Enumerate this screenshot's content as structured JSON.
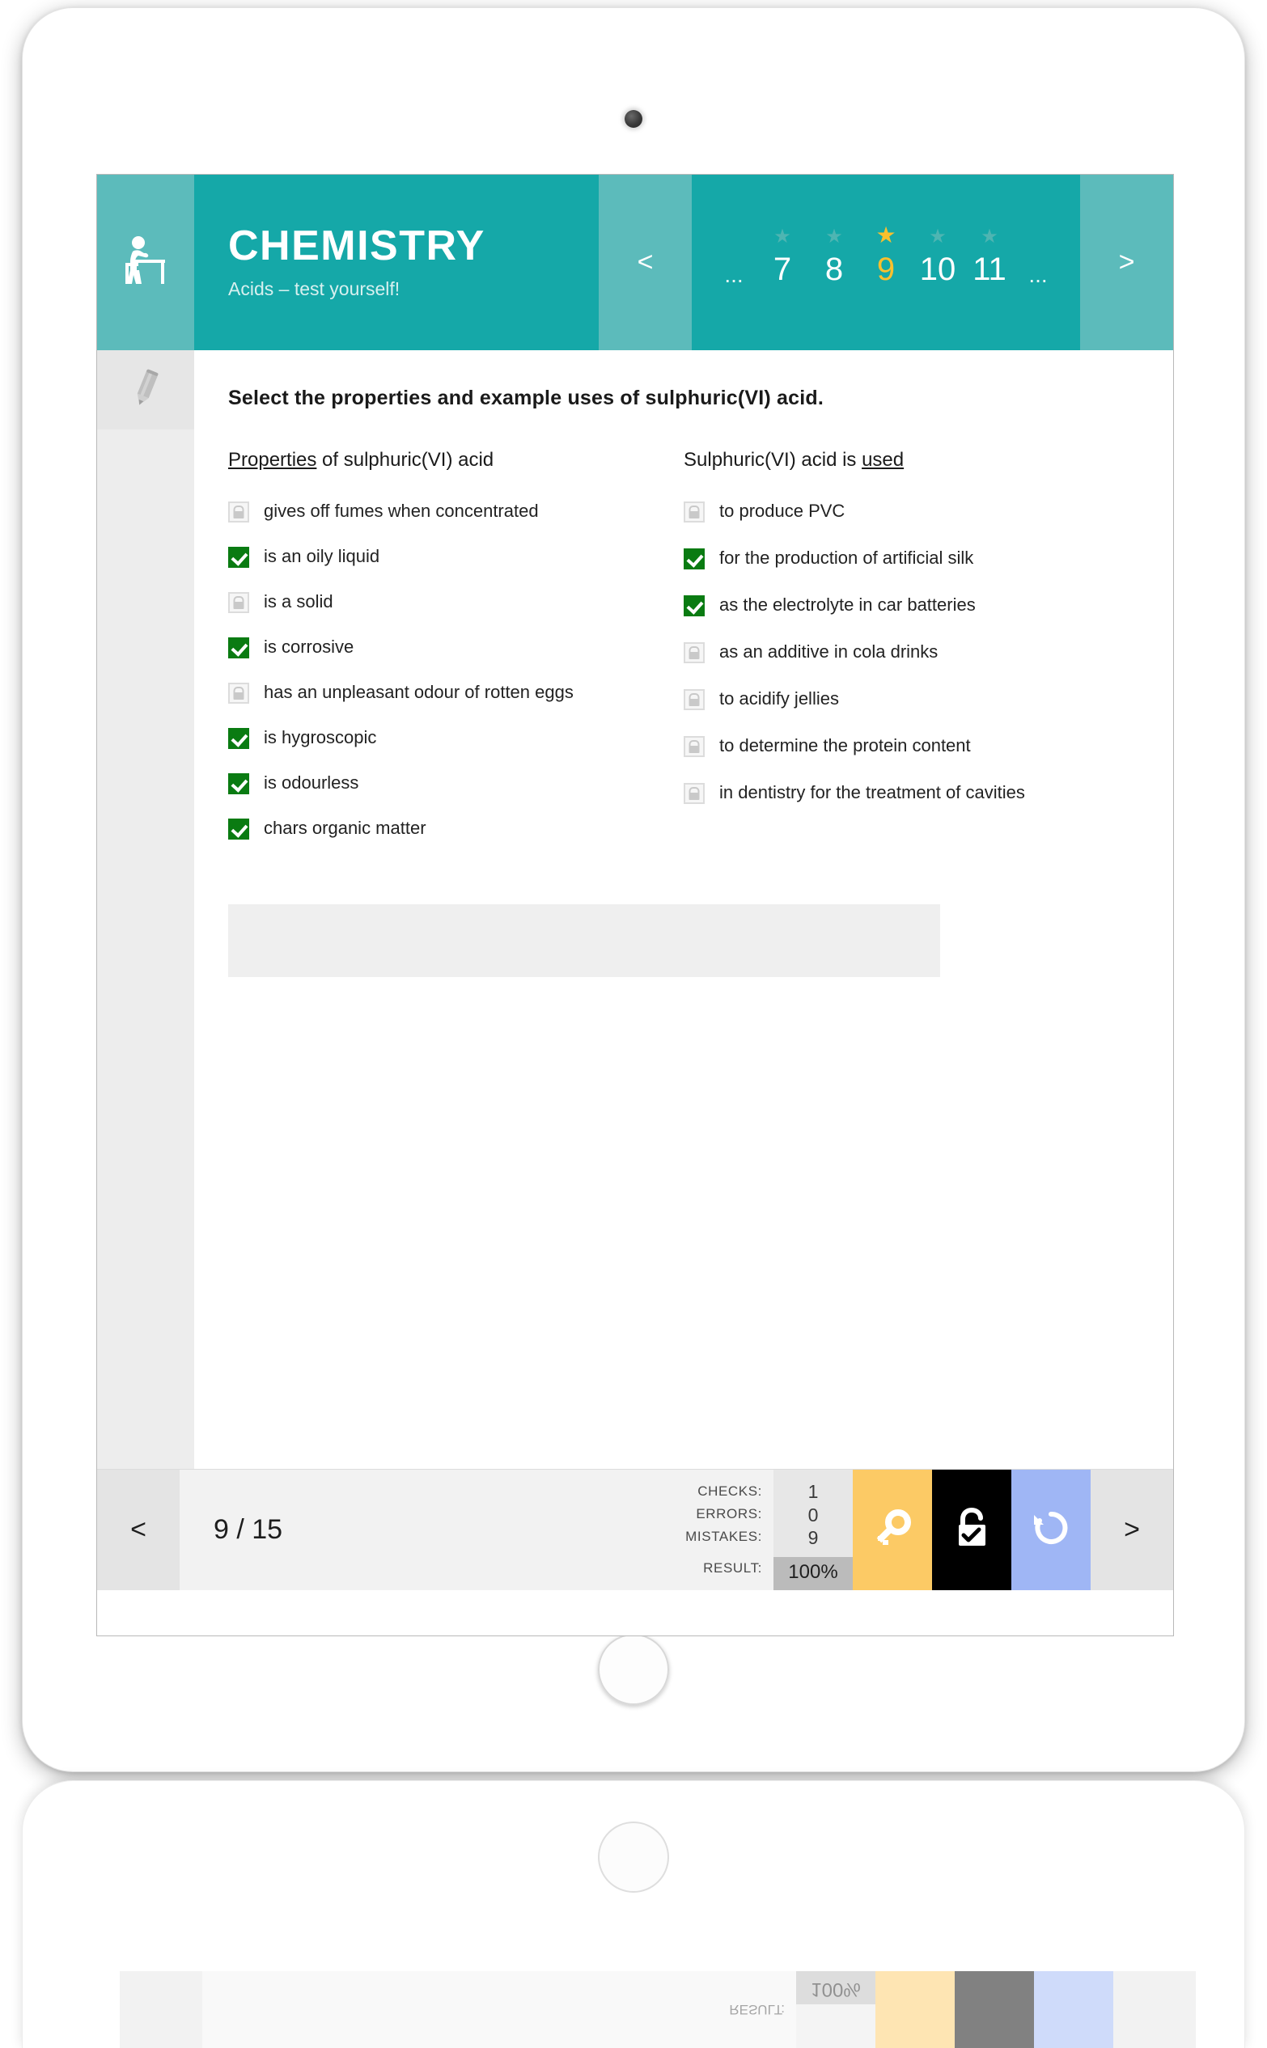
{
  "app": {
    "header": {
      "title": "CHEMISTRY",
      "subtitle": "Acids – test yourself!",
      "student_icon": "student-at-desk-icon",
      "prev_label": "<",
      "next_label": ">",
      "pager": [
        {
          "label": "...",
          "kind": "ellipsis",
          "star": false,
          "active": false
        },
        {
          "label": "7",
          "kind": "page",
          "star": true,
          "active": false
        },
        {
          "label": "8",
          "kind": "page",
          "star": true,
          "active": false
        },
        {
          "label": "9",
          "kind": "page",
          "star": true,
          "active": true
        },
        {
          "label": "10",
          "kind": "page",
          "star": true,
          "active": false
        },
        {
          "label": "11",
          "kind": "page",
          "star": true,
          "active": false
        },
        {
          "label": "...",
          "kind": "ellipsis",
          "star": false,
          "active": false
        }
      ]
    },
    "sidebar": {
      "tools": [
        {
          "name": "pencil-tool",
          "icon": "pencil-icon"
        }
      ]
    },
    "main": {
      "question": "Select the properties and example uses of sulphuric(VI) acid.",
      "columns": [
        {
          "head_pre": "",
          "head_underline": "Properties",
          "head_post": " of sulphuric(VI) acid",
          "options": [
            {
              "label": "gives off fumes when concentrated",
              "state": "locked"
            },
            {
              "label": "is an oily liquid",
              "state": "checked"
            },
            {
              "label": "is a solid",
              "state": "locked"
            },
            {
              "label": "is corrosive",
              "state": "checked"
            },
            {
              "label": "has an unpleasant odour of rotten eggs",
              "state": "locked"
            },
            {
              "label": "is hygroscopic",
              "state": "checked"
            },
            {
              "label": "is odourless",
              "state": "checked"
            },
            {
              "label": "chars organic matter",
              "state": "checked"
            }
          ]
        },
        {
          "head_pre": "Sulphuric(VI) acid is ",
          "head_underline": "used",
          "head_post": "",
          "options": [
            {
              "label": "to produce PVC",
              "state": "locked"
            },
            {
              "label": "for the production of artificial silk",
              "state": "checked"
            },
            {
              "label": "as the electrolyte in car batteries",
              "state": "checked"
            },
            {
              "label": "as an additive in cola drinks",
              "state": "locked"
            },
            {
              "label": "to acidify jellies",
              "state": "locked"
            },
            {
              "label": "to determine the protein content",
              "state": "locked"
            },
            {
              "label": "in dentistry for the treatment of cavities",
              "state": "locked"
            }
          ]
        }
      ]
    },
    "footer": {
      "prev_label": "<",
      "next_label": ">",
      "counter": "9 / 15",
      "stats": {
        "checks_label": "CHECKS:",
        "errors_label": "ERRORS:",
        "mistakes_label": "MISTAKES:",
        "result_label": "RESULT:",
        "checks_value": "1",
        "errors_value": "0",
        "mistakes_value": "9",
        "result_value": "100%"
      },
      "buttons": [
        {
          "name": "show-answer-key-button",
          "icon": "key-icon",
          "color": "#fcca65"
        },
        {
          "name": "check-answers-button",
          "icon": "unlock-check-icon",
          "color": "#000000"
        },
        {
          "name": "reset-exercise-button",
          "icon": "undo-refresh-icon",
          "color": "#9fb6f5"
        }
      ]
    },
    "colors": {
      "brand_teal": "#15a8a8",
      "brand_teal_light": "#5cbbbb",
      "accent_gold": "#fbc02d",
      "checked_green": "#0a7b12",
      "key_amber": "#fcca65",
      "redo_blue": "#9fb6f5"
    }
  }
}
